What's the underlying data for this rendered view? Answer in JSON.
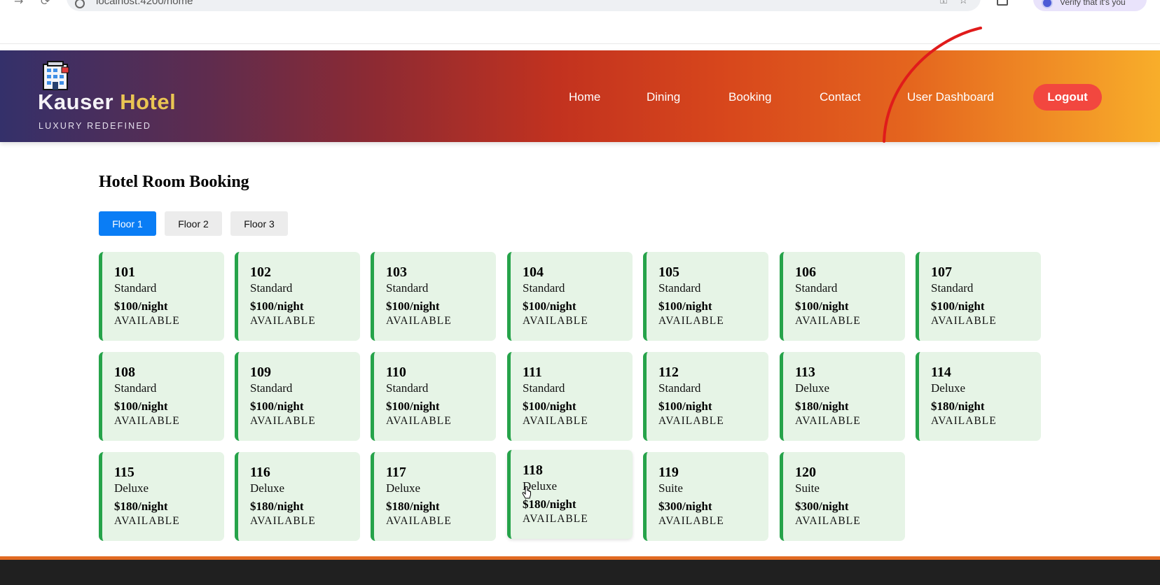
{
  "browser": {
    "url": "localhost:4200/home",
    "profile_text": "Verify that it's you",
    "icons": [
      "back-arrow-icon",
      "reload-icon",
      "site-info-icon",
      "key-icon",
      "bookmark-star-icon",
      "extensions-icon",
      "profile-avatar-icon"
    ]
  },
  "header": {
    "brand_part1": "Kauser",
    "brand_part2": "Hotel",
    "tagline": "LUXURY REDEFINED",
    "nav": [
      {
        "label": "Home"
      },
      {
        "label": "Dining"
      },
      {
        "label": "Booking"
      },
      {
        "label": "Contact"
      },
      {
        "label": "User Dashboard"
      }
    ],
    "logout_label": "Logout",
    "colors": {
      "accent": "#f2473f",
      "brand_gold": "#eac553"
    }
  },
  "main": {
    "title": "Hotel Room Booking",
    "floor_tabs": [
      {
        "label": "Floor 1",
        "active": true
      },
      {
        "label": "Floor 2",
        "active": false
      },
      {
        "label": "Floor 3",
        "active": false
      }
    ],
    "rooms": [
      {
        "number": "101",
        "type": "Standard",
        "price": "$100/night",
        "status": "AVAILABLE"
      },
      {
        "number": "102",
        "type": "Standard",
        "price": "$100/night",
        "status": "AVAILABLE"
      },
      {
        "number": "103",
        "type": "Standard",
        "price": "$100/night",
        "status": "AVAILABLE"
      },
      {
        "number": "104",
        "type": "Standard",
        "price": "$100/night",
        "status": "AVAILABLE"
      },
      {
        "number": "105",
        "type": "Standard",
        "price": "$100/night",
        "status": "AVAILABLE"
      },
      {
        "number": "106",
        "type": "Standard",
        "price": "$100/night",
        "status": "AVAILABLE"
      },
      {
        "number": "107",
        "type": "Standard",
        "price": "$100/night",
        "status": "AVAILABLE"
      },
      {
        "number": "108",
        "type": "Standard",
        "price": "$100/night",
        "status": "AVAILABLE"
      },
      {
        "number": "109",
        "type": "Standard",
        "price": "$100/night",
        "status": "AVAILABLE"
      },
      {
        "number": "110",
        "type": "Standard",
        "price": "$100/night",
        "status": "AVAILABLE"
      },
      {
        "number": "111",
        "type": "Standard",
        "price": "$100/night",
        "status": "AVAILABLE"
      },
      {
        "number": "112",
        "type": "Standard",
        "price": "$100/night",
        "status": "AVAILABLE"
      },
      {
        "number": "113",
        "type": "Deluxe",
        "price": "$180/night",
        "status": "AVAILABLE"
      },
      {
        "number": "114",
        "type": "Deluxe",
        "price": "$180/night",
        "status": "AVAILABLE"
      },
      {
        "number": "115",
        "type": "Deluxe",
        "price": "$180/night",
        "status": "AVAILABLE"
      },
      {
        "number": "116",
        "type": "Deluxe",
        "price": "$180/night",
        "status": "AVAILABLE"
      },
      {
        "number": "117",
        "type": "Deluxe",
        "price": "$180/night",
        "status": "AVAILABLE"
      },
      {
        "number": "118",
        "type": "Deluxe",
        "price": "$180/night",
        "status": "AVAILABLE"
      },
      {
        "number": "119",
        "type": "Suite",
        "price": "$300/night",
        "status": "AVAILABLE"
      },
      {
        "number": "120",
        "type": "Suite",
        "price": "$300/night",
        "status": "AVAILABLE"
      }
    ],
    "colors": {
      "card_bg": "#e6f4e6",
      "card_border": "#26a34a",
      "tab_active": "#0a7df5"
    }
  }
}
